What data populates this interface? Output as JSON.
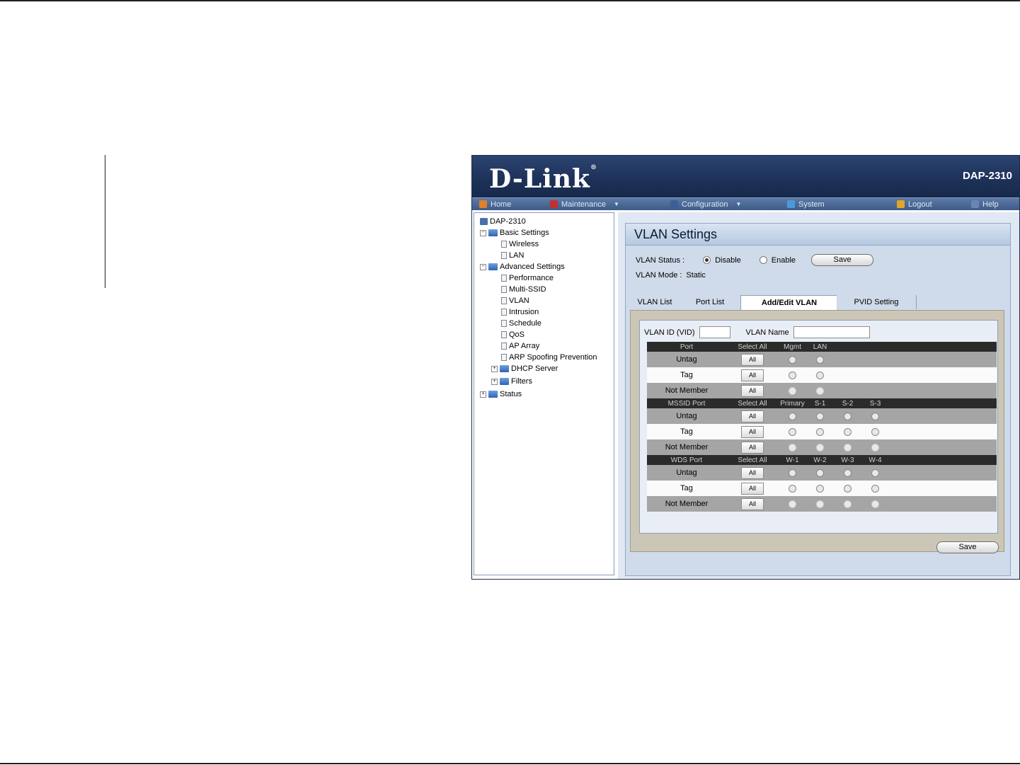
{
  "brand": {
    "logo": "D-Link",
    "model": "DAP-2310"
  },
  "menu": [
    {
      "label": "Home",
      "icon": "home-icon",
      "color": "#e0802a",
      "dropdown": false
    },
    {
      "label": "Maintenance",
      "icon": "tools-icon",
      "color": "#c03030",
      "dropdown": true
    },
    {
      "label": "Configuration",
      "icon": "disk-icon",
      "color": "#3d5f98",
      "dropdown": true
    },
    {
      "label": "System",
      "icon": "network-icon",
      "color": "#4a9ad8",
      "dropdown": false
    },
    {
      "label": "Logout",
      "icon": "logout-icon",
      "color": "#e2a52a",
      "dropdown": false
    },
    {
      "label": "Help",
      "icon": "help-icon",
      "color": "#6a85b0",
      "dropdown": false
    }
  ],
  "tree": {
    "root": "DAP-2310",
    "basic": {
      "label": "Basic Settings",
      "items": [
        "Wireless",
        "LAN"
      ]
    },
    "advanced": {
      "label": "Advanced Settings",
      "items": [
        "Performance",
        "Multi-SSID",
        "VLAN",
        "Intrusion",
        "Schedule",
        "QoS",
        "AP Array",
        "ARP Spoofing Prevention"
      ],
      "folders": [
        "DHCP Server",
        "Filters"
      ]
    },
    "status": "Status"
  },
  "panel": {
    "title": "VLAN Settings",
    "vlan_status_label": "VLAN Status :",
    "disable_label": "Disable",
    "enable_label": "Enable",
    "save_label": "Save",
    "vlan_mode_label": "VLAN Mode :",
    "vlan_mode_value": "Static",
    "tabs": [
      "VLAN List",
      "Port List",
      "Add/Edit VLAN",
      "PVID Setting"
    ],
    "active_tab": "Add/Edit VLAN",
    "vlan_id_label": "VLAN ID (VID)",
    "vlan_name_label": "VLAN Name",
    "bottom_save_label": "Save"
  },
  "groups": [
    {
      "headers": [
        "Port",
        "Select All",
        "Mgmt",
        "LAN"
      ],
      "ports": 2
    },
    {
      "headers": [
        "MSSID Port",
        "Select All",
        "Primary",
        "S-1",
        "S-2",
        "S-3"
      ],
      "ports": 4
    },
    {
      "headers": [
        "WDS Port",
        "Select All",
        "W-1",
        "W-2",
        "W-3",
        "W-4"
      ],
      "ports": 4
    }
  ],
  "rows": [
    "Untag",
    "Tag",
    "Not Member"
  ],
  "all_label": "All"
}
